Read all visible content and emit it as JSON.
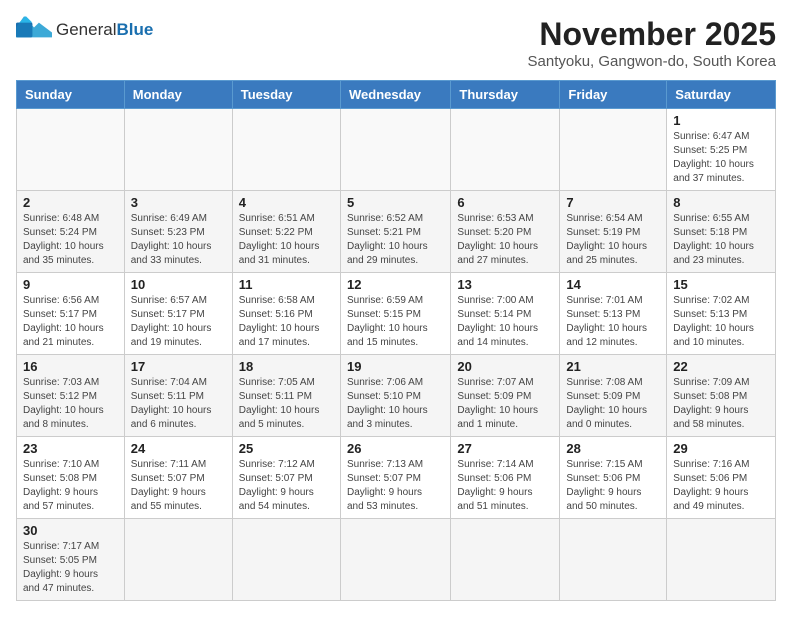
{
  "header": {
    "logo_general": "General",
    "logo_blue": "Blue",
    "title": "November 2025",
    "subtitle": "Santyoku, Gangwon-do, South Korea"
  },
  "weekdays": [
    "Sunday",
    "Monday",
    "Tuesday",
    "Wednesday",
    "Thursday",
    "Friday",
    "Saturday"
  ],
  "weeks": [
    [
      {
        "day": "",
        "info": ""
      },
      {
        "day": "",
        "info": ""
      },
      {
        "day": "",
        "info": ""
      },
      {
        "day": "",
        "info": ""
      },
      {
        "day": "",
        "info": ""
      },
      {
        "day": "",
        "info": ""
      },
      {
        "day": "1",
        "info": "Sunrise: 6:47 AM\nSunset: 5:25 PM\nDaylight: 10 hours\nand 37 minutes."
      }
    ],
    [
      {
        "day": "2",
        "info": "Sunrise: 6:48 AM\nSunset: 5:24 PM\nDaylight: 10 hours\nand 35 minutes."
      },
      {
        "day": "3",
        "info": "Sunrise: 6:49 AM\nSunset: 5:23 PM\nDaylight: 10 hours\nand 33 minutes."
      },
      {
        "day": "4",
        "info": "Sunrise: 6:51 AM\nSunset: 5:22 PM\nDaylight: 10 hours\nand 31 minutes."
      },
      {
        "day": "5",
        "info": "Sunrise: 6:52 AM\nSunset: 5:21 PM\nDaylight: 10 hours\nand 29 minutes."
      },
      {
        "day": "6",
        "info": "Sunrise: 6:53 AM\nSunset: 5:20 PM\nDaylight: 10 hours\nand 27 minutes."
      },
      {
        "day": "7",
        "info": "Sunrise: 6:54 AM\nSunset: 5:19 PM\nDaylight: 10 hours\nand 25 minutes."
      },
      {
        "day": "8",
        "info": "Sunrise: 6:55 AM\nSunset: 5:18 PM\nDaylight: 10 hours\nand 23 minutes."
      }
    ],
    [
      {
        "day": "9",
        "info": "Sunrise: 6:56 AM\nSunset: 5:17 PM\nDaylight: 10 hours\nand 21 minutes."
      },
      {
        "day": "10",
        "info": "Sunrise: 6:57 AM\nSunset: 5:17 PM\nDaylight: 10 hours\nand 19 minutes."
      },
      {
        "day": "11",
        "info": "Sunrise: 6:58 AM\nSunset: 5:16 PM\nDaylight: 10 hours\nand 17 minutes."
      },
      {
        "day": "12",
        "info": "Sunrise: 6:59 AM\nSunset: 5:15 PM\nDaylight: 10 hours\nand 15 minutes."
      },
      {
        "day": "13",
        "info": "Sunrise: 7:00 AM\nSunset: 5:14 PM\nDaylight: 10 hours\nand 14 minutes."
      },
      {
        "day": "14",
        "info": "Sunrise: 7:01 AM\nSunset: 5:13 PM\nDaylight: 10 hours\nand 12 minutes."
      },
      {
        "day": "15",
        "info": "Sunrise: 7:02 AM\nSunset: 5:13 PM\nDaylight: 10 hours\nand 10 minutes."
      }
    ],
    [
      {
        "day": "16",
        "info": "Sunrise: 7:03 AM\nSunset: 5:12 PM\nDaylight: 10 hours\nand 8 minutes."
      },
      {
        "day": "17",
        "info": "Sunrise: 7:04 AM\nSunset: 5:11 PM\nDaylight: 10 hours\nand 6 minutes."
      },
      {
        "day": "18",
        "info": "Sunrise: 7:05 AM\nSunset: 5:11 PM\nDaylight: 10 hours\nand 5 minutes."
      },
      {
        "day": "19",
        "info": "Sunrise: 7:06 AM\nSunset: 5:10 PM\nDaylight: 10 hours\nand 3 minutes."
      },
      {
        "day": "20",
        "info": "Sunrise: 7:07 AM\nSunset: 5:09 PM\nDaylight: 10 hours\nand 1 minute."
      },
      {
        "day": "21",
        "info": "Sunrise: 7:08 AM\nSunset: 5:09 PM\nDaylight: 10 hours\nand 0 minutes."
      },
      {
        "day": "22",
        "info": "Sunrise: 7:09 AM\nSunset: 5:08 PM\nDaylight: 9 hours\nand 58 minutes."
      }
    ],
    [
      {
        "day": "23",
        "info": "Sunrise: 7:10 AM\nSunset: 5:08 PM\nDaylight: 9 hours\nand 57 minutes."
      },
      {
        "day": "24",
        "info": "Sunrise: 7:11 AM\nSunset: 5:07 PM\nDaylight: 9 hours\nand 55 minutes."
      },
      {
        "day": "25",
        "info": "Sunrise: 7:12 AM\nSunset: 5:07 PM\nDaylight: 9 hours\nand 54 minutes."
      },
      {
        "day": "26",
        "info": "Sunrise: 7:13 AM\nSunset: 5:07 PM\nDaylight: 9 hours\nand 53 minutes."
      },
      {
        "day": "27",
        "info": "Sunrise: 7:14 AM\nSunset: 5:06 PM\nDaylight: 9 hours\nand 51 minutes."
      },
      {
        "day": "28",
        "info": "Sunrise: 7:15 AM\nSunset: 5:06 PM\nDaylight: 9 hours\nand 50 minutes."
      },
      {
        "day": "29",
        "info": "Sunrise: 7:16 AM\nSunset: 5:06 PM\nDaylight: 9 hours\nand 49 minutes."
      }
    ],
    [
      {
        "day": "30",
        "info": "Sunrise: 7:17 AM\nSunset: 5:05 PM\nDaylight: 9 hours\nand 47 minutes."
      },
      {
        "day": "",
        "info": ""
      },
      {
        "day": "",
        "info": ""
      },
      {
        "day": "",
        "info": ""
      },
      {
        "day": "",
        "info": ""
      },
      {
        "day": "",
        "info": ""
      },
      {
        "day": "",
        "info": ""
      }
    ]
  ]
}
